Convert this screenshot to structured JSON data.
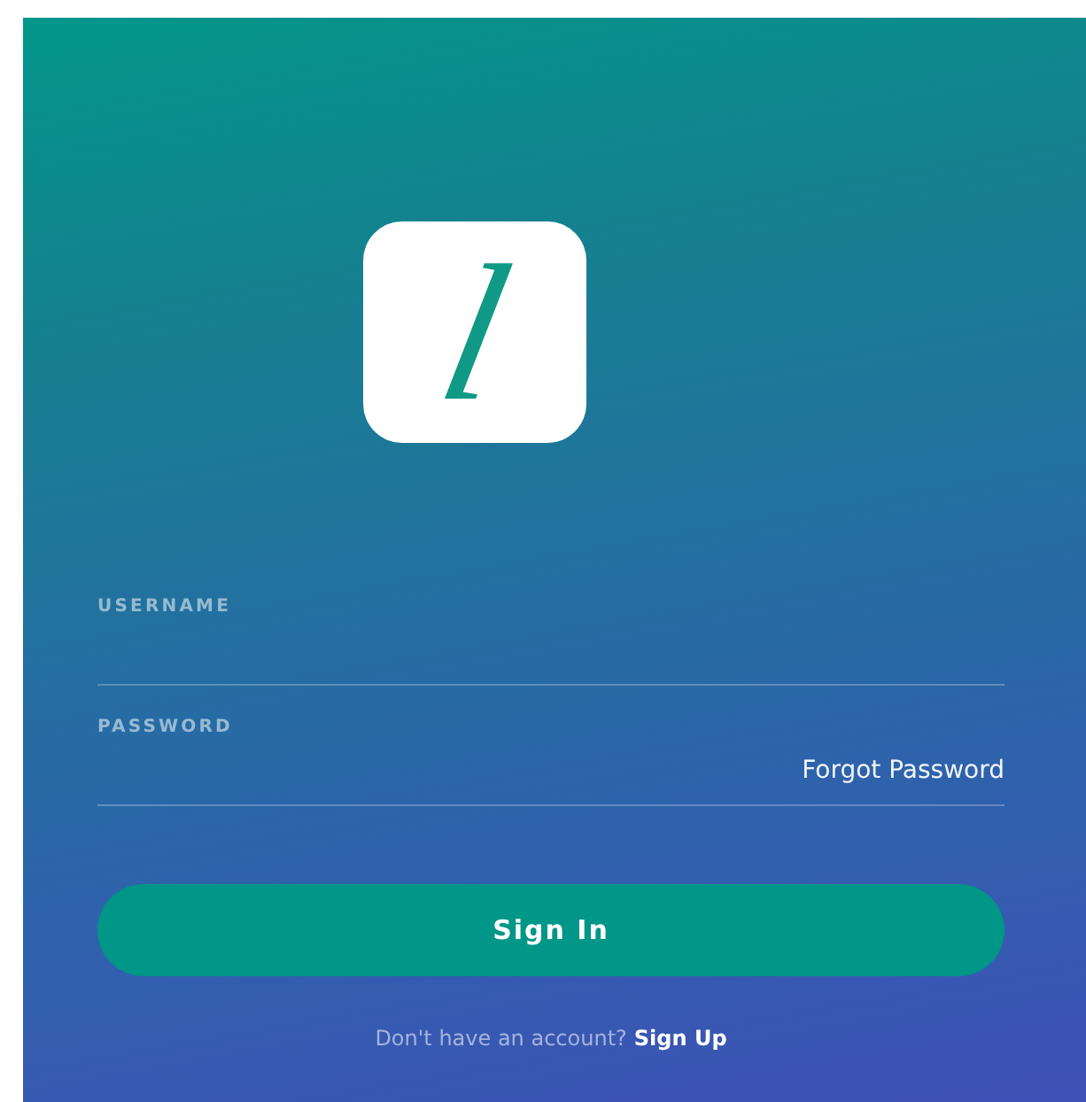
{
  "logo": {
    "letter": "l"
  },
  "fields": [
    {
      "label": "USERNAME"
    },
    {
      "label": "PASSWORD",
      "link": "Forgot Password"
    }
  ],
  "sign_in_button": "Sign In",
  "footer": {
    "prompt": "Don't have an account?",
    "link": "Sign Up"
  }
}
